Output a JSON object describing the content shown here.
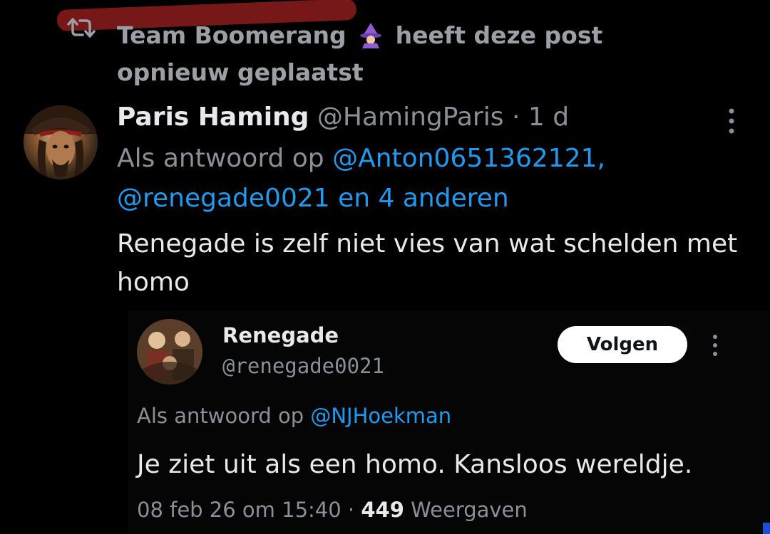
{
  "repost": {
    "user": "Team Boomerang",
    "emoji": "🧙",
    "action": "heeft deze post opnieuw geplaatst"
  },
  "tweet": {
    "author_name": "Paris Haming",
    "author_handle": "@HamingParis",
    "separator": "·",
    "time": "1 d",
    "reply_prefix": "Als antwoord op",
    "reply_to_1": "@Anton0651362121,",
    "reply_to_2": "@renegade0021 en 4 anderen",
    "text": "Renegade is zelf niet vies van wat schelden met homo"
  },
  "embedded": {
    "name": "Renegade",
    "handle": "@renegade0021",
    "follow_label": "Volgen",
    "reply_prefix": "Als antwoord op",
    "reply_to": "@NJHoekman",
    "text": "Je ziet uit als een homo. Kansloos wereldje.",
    "timestamp": "08 feb 26 om 15:40",
    "separator": "·",
    "views": "449",
    "views_label": "Weergaven"
  },
  "icons": {
    "repost": "repost-icon",
    "wizard": "wizard-emoji-icon",
    "more": "more-options-icon"
  },
  "colors": {
    "background": "#000000",
    "text": "#e7e9ea",
    "muted": "#8b9096",
    "link": "#1d9bf0",
    "strike": "#8c1c1c"
  }
}
